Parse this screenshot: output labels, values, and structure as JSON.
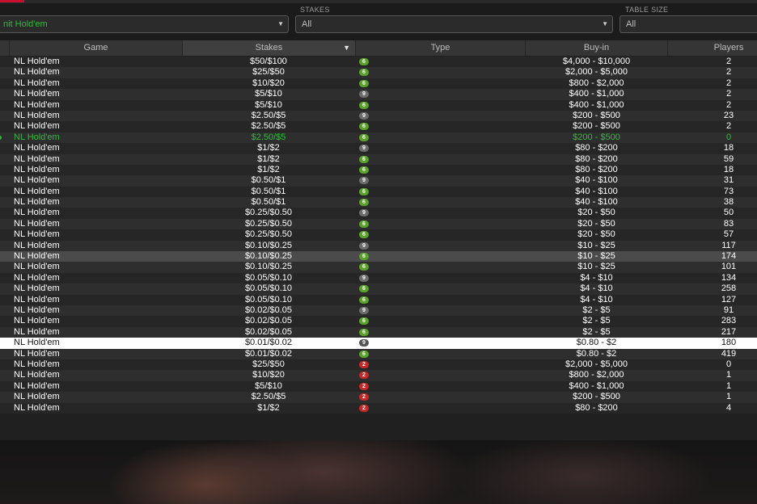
{
  "filters": {
    "game": {
      "value": "nit Hold'em"
    },
    "stakes": {
      "label": "STAKES",
      "value": "All"
    },
    "table_size": {
      "label": "TABLE SIZE",
      "value": "All"
    }
  },
  "columns": {
    "game": "Game",
    "stakes": "Stakes",
    "type": "Type",
    "buyin": "Buy-in",
    "players": "Players"
  },
  "colors": {
    "six_max": "#5aa229",
    "nine_max": "#6c6c6c",
    "heads_up": "#c62828",
    "active_text": "#2fbd3a"
  },
  "rows": [
    {
      "game": "NL Hold'em",
      "stakes": "$50/$100",
      "seats": "6",
      "buyin": "$4,000 - $10,000",
      "players": "2"
    },
    {
      "game": "NL Hold'em",
      "stakes": "$25/$50",
      "seats": "6",
      "buyin": "$2,000 - $5,000",
      "players": "2"
    },
    {
      "game": "NL Hold'em",
      "stakes": "$10/$20",
      "seats": "6",
      "buyin": "$800 - $2,000",
      "players": "2"
    },
    {
      "game": "NL Hold'em",
      "stakes": "$5/$10",
      "seats": "9",
      "buyin": "$400 - $1,000",
      "players": "2"
    },
    {
      "game": "NL Hold'em",
      "stakes": "$5/$10",
      "seats": "6",
      "buyin": "$400 - $1,000",
      "players": "2"
    },
    {
      "game": "NL Hold'em",
      "stakes": "$2.50/$5",
      "seats": "9",
      "buyin": "$200 - $500",
      "players": "23"
    },
    {
      "game": "NL Hold'em",
      "stakes": "$2.50/$5",
      "seats": "6",
      "buyin": "$200 - $500",
      "players": "2"
    },
    {
      "game": "NL Hold'em",
      "stakes": "$2.50/$5",
      "seats": "6",
      "buyin": "$200 - $500",
      "players": "0",
      "state": "active"
    },
    {
      "game": "NL Hold'em",
      "stakes": "$1/$2",
      "seats": "9",
      "buyin": "$80 - $200",
      "players": "18"
    },
    {
      "game": "NL Hold'em",
      "stakes": "$1/$2",
      "seats": "6",
      "buyin": "$80 - $200",
      "players": "59"
    },
    {
      "game": "NL Hold'em",
      "stakes": "$1/$2",
      "seats": "6",
      "buyin": "$80 - $200",
      "players": "18"
    },
    {
      "game": "NL Hold'em",
      "stakes": "$0.50/$1",
      "seats": "9",
      "buyin": "$40 - $100",
      "players": "31"
    },
    {
      "game": "NL Hold'em",
      "stakes": "$0.50/$1",
      "seats": "6",
      "buyin": "$40 - $100",
      "players": "73"
    },
    {
      "game": "NL Hold'em",
      "stakes": "$0.50/$1",
      "seats": "6",
      "buyin": "$40 - $100",
      "players": "38"
    },
    {
      "game": "NL Hold'em",
      "stakes": "$0.25/$0.50",
      "seats": "9",
      "buyin": "$20 - $50",
      "players": "50"
    },
    {
      "game": "NL Hold'em",
      "stakes": "$0.25/$0.50",
      "seats": "6",
      "buyin": "$20 - $50",
      "players": "83"
    },
    {
      "game": "NL Hold'em",
      "stakes": "$0.25/$0.50",
      "seats": "6",
      "buyin": "$20 - $50",
      "players": "57"
    },
    {
      "game": "NL Hold'em",
      "stakes": "$0.10/$0.25",
      "seats": "9",
      "buyin": "$10 - $25",
      "players": "117"
    },
    {
      "game": "NL Hold'em",
      "stakes": "$0.10/$0.25",
      "seats": "6",
      "buyin": "$10 - $25",
      "players": "174",
      "state": "hover"
    },
    {
      "game": "NL Hold'em",
      "stakes": "$0.10/$0.25",
      "seats": "6",
      "buyin": "$10 - $25",
      "players": "101"
    },
    {
      "game": "NL Hold'em",
      "stakes": "$0.05/$0.10",
      "seats": "9",
      "buyin": "$4 - $10",
      "players": "134"
    },
    {
      "game": "NL Hold'em",
      "stakes": "$0.05/$0.10",
      "seats": "6",
      "buyin": "$4 - $10",
      "players": "258"
    },
    {
      "game": "NL Hold'em",
      "stakes": "$0.05/$0.10",
      "seats": "6",
      "buyin": "$4 - $10",
      "players": "127"
    },
    {
      "game": "NL Hold'em",
      "stakes": "$0.02/$0.05",
      "seats": "9",
      "buyin": "$2 - $5",
      "players": "91"
    },
    {
      "game": "NL Hold'em",
      "stakes": "$0.02/$0.05",
      "seats": "6",
      "buyin": "$2 - $5",
      "players": "283"
    },
    {
      "game": "NL Hold'em",
      "stakes": "$0.02/$0.05",
      "seats": "6",
      "buyin": "$2 - $5",
      "players": "217"
    },
    {
      "game": "NL Hold'em",
      "stakes": "$0.01/$0.02",
      "seats": "9",
      "buyin": "$0.80 - $2",
      "players": "180",
      "state": "selected"
    },
    {
      "game": "NL Hold'em",
      "stakes": "$0.01/$0.02",
      "seats": "6",
      "buyin": "$0.80 - $2",
      "players": "419"
    },
    {
      "game": "NL Hold'em",
      "stakes": "$25/$50",
      "seats": "2",
      "buyin": "$2,000 - $5,000",
      "players": "0"
    },
    {
      "game": "NL Hold'em",
      "stakes": "$10/$20",
      "seats": "2",
      "buyin": "$800 - $2,000",
      "players": "1"
    },
    {
      "game": "NL Hold'em",
      "stakes": "$5/$10",
      "seats": "2",
      "buyin": "$400 - $1,000",
      "players": "1"
    },
    {
      "game": "NL Hold'em",
      "stakes": "$2.50/$5",
      "seats": "2",
      "buyin": "$200 - $500",
      "players": "1"
    },
    {
      "game": "NL Hold'em",
      "stakes": "$1/$2",
      "seats": "2",
      "buyin": "$80 - $200",
      "players": "4"
    }
  ]
}
